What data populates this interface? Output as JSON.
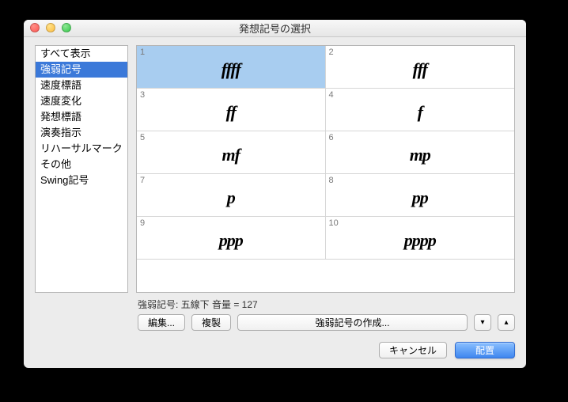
{
  "window": {
    "title": "発想記号の選択"
  },
  "sidebar": {
    "items": [
      {
        "label": "すべて表示",
        "selected": false
      },
      {
        "label": "強弱記号",
        "selected": true
      },
      {
        "label": "速度標語",
        "selected": false
      },
      {
        "label": "速度変化",
        "selected": false
      },
      {
        "label": "発想標語",
        "selected": false
      },
      {
        "label": "演奏指示",
        "selected": false
      },
      {
        "label": "リハーサルマーク",
        "selected": false
      },
      {
        "label": "その他",
        "selected": false
      },
      {
        "label": "Swing記号",
        "selected": false
      }
    ]
  },
  "grid": {
    "cells": [
      {
        "num": "1",
        "glyph": "ffff",
        "selected": true
      },
      {
        "num": "2",
        "glyph": "fff",
        "selected": false
      },
      {
        "num": "3",
        "glyph": "ff",
        "selected": false
      },
      {
        "num": "4",
        "glyph": "f",
        "selected": false
      },
      {
        "num": "5",
        "glyph": "mf",
        "selected": false
      },
      {
        "num": "6",
        "glyph": "mp",
        "selected": false
      },
      {
        "num": "7",
        "glyph": "p",
        "selected": false
      },
      {
        "num": "8",
        "glyph": "pp",
        "selected": false
      },
      {
        "num": "9",
        "glyph": "ppp",
        "selected": false
      },
      {
        "num": "10",
        "glyph": "pppp",
        "selected": false
      }
    ]
  },
  "status": "強弱記号: 五線下 音量 = 127",
  "buttons": {
    "edit": "編集...",
    "dup": "複製",
    "create": "強弱記号の作成...",
    "down": "⌄",
    "up": "⌃",
    "cancel": "キャンセル",
    "ok": "配置"
  }
}
